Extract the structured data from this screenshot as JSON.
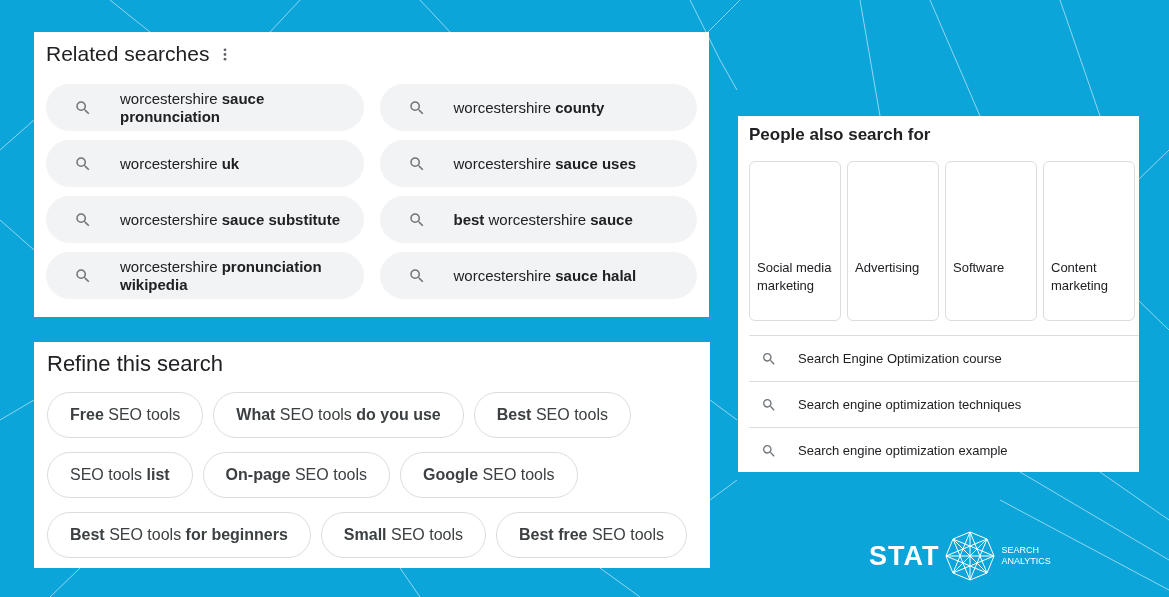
{
  "related_searches": {
    "title": "Related searches",
    "items": [
      {
        "text": "worcestershire **sauce pronunciation**"
      },
      {
        "text": "worcestershire **county**"
      },
      {
        "text": "worcestershire **uk**"
      },
      {
        "text": "worcestershire **sauce uses**"
      },
      {
        "text": "worcestershire **sauce substitute**"
      },
      {
        "text": "**best** worcestershire **sauce**"
      },
      {
        "text": "worcestershire **pronunciation wikipedia**"
      },
      {
        "text": "worcestershire **sauce halal**"
      }
    ]
  },
  "refine_search": {
    "title": "Refine this search",
    "rows": [
      [
        "**Free** SEO tools",
        "**What** SEO tools **do you use**",
        "**Best** SEO tools"
      ],
      [
        "SEO tools **list**",
        "**On-page** SEO tools",
        "**Google** SEO tools"
      ],
      [
        "**Best** SEO tools **for beginners**",
        "**Small** SEO tools",
        "**Best free** SEO tools"
      ]
    ]
  },
  "people_also_search": {
    "title": "People also search for",
    "cards": [
      "Social media marketing",
      "Advertising",
      "Software",
      "Content marketing"
    ],
    "suggestions": [
      "Search Engine Optimization course",
      "Search engine optimization techniques",
      "Search engine optimization example"
    ]
  },
  "logo": {
    "wordmark": "STAT",
    "tagline": [
      "SEARCH",
      "ANALYTICS"
    ]
  }
}
